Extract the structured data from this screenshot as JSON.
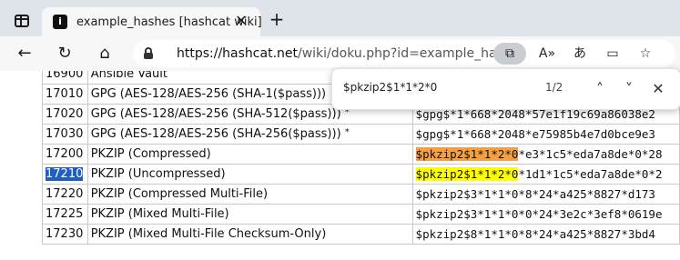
{
  "browser": {
    "tab": {
      "favicon_text": "i",
      "title": "example_hashes [hashcat wiki]",
      "close_label": "✕"
    },
    "new_tab_label": "+",
    "url_host": "https://hashcat.net",
    "url_path": "/wiki/doku.php?id=example_hashes",
    "find_button_icon": "find-on-page-icon"
  },
  "find": {
    "query": "$pkzip2$1*1*2*0",
    "count": "1/2"
  },
  "table": {
    "rows": [
      {
        "mode": "16900",
        "name": "Ansible Vault",
        "star": "",
        "example": ""
      },
      {
        "mode": "17010",
        "name": "GPG (AES-128/AES-256 (SHA-1($pass)))",
        "star": "",
        "example": ""
      },
      {
        "mode": "17020",
        "name": "GPG (AES-128/AES-256 (SHA-512($pass)))",
        "star": "*",
        "example": "$gpg$*1*668*2048*57e1f19c69a86038e2"
      },
      {
        "mode": "17030",
        "name": "GPG (AES-128/AES-256 (SHA-256($pass)))",
        "star": "*",
        "example": "$gpg$*1*668*2048*e75985b4e7d0bce9e3"
      },
      {
        "mode": "17200",
        "name": "PKZIP (Compressed)",
        "star": "",
        "example_hl": "$pkzip2$1*1*2*0",
        "example": "*e3*1c5*eda7a8de*0*28"
      },
      {
        "mode": "17210",
        "name": "PKZIP (Uncompressed)",
        "star": "",
        "example_hl": "$pkzip2$1*1*2*0",
        "example": "*1d1*1c5*eda7a8de*0*2"
      },
      {
        "mode": "17220",
        "name": "PKZIP (Compressed Multi-File)",
        "star": "",
        "example": "$pkzip2$3*1*1*0*8*24*a425*8827*d173"
      },
      {
        "mode": "17225",
        "name": "PKZIP (Mixed Multi-File)",
        "star": "",
        "example": "$pkzip2$3*1*1*0*0*24*3e2c*3ef8*0619e"
      },
      {
        "mode": "17230",
        "name": "PKZIP (Mixed Multi-File Checksum-Only)",
        "star": "",
        "example": "$pkzip2$8*1*1*0*8*24*a425*8827*3bd4"
      }
    ]
  }
}
